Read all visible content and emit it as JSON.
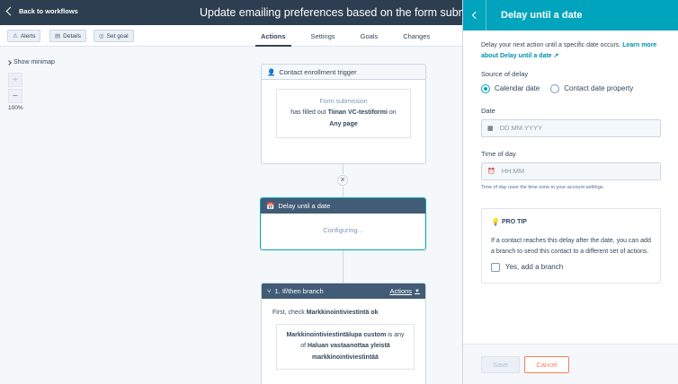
{
  "header": {
    "back_label": "Back to workflows",
    "workflow_title": "Update emailing preferences based on the form submission"
  },
  "toolbar": {
    "alerts_label": "Alerts",
    "details_label": "Details",
    "set_goal_label": "Set goal",
    "tabs": [
      {
        "label": "Actions",
        "active": true
      },
      {
        "label": "Settings",
        "active": false
      },
      {
        "label": "Goals",
        "active": false
      },
      {
        "label": "Changes",
        "active": false
      }
    ]
  },
  "canvas": {
    "minimap_label": "Show minimap",
    "zoom_in": "+",
    "zoom_out": "−",
    "zoom_level": "100%",
    "trigger": {
      "header": "Contact enrollment trigger",
      "line1": "Form submission",
      "line2_prefix": "has filled out",
      "form_name": "Tiinan VC-testiformi",
      "line2_suffix": "on",
      "line3": "Any page"
    },
    "delay_card": {
      "header": "Delay until a date",
      "body": "Configuring..."
    },
    "branch_card": {
      "header": "1. If/then branch",
      "actions_label": "Actions",
      "first_check_prefix": "First, check",
      "first_check_name": "Markkinointiviestintä ok",
      "property": "Markkinointiviestintälupa custom",
      "is_any_of": "is any",
      "of_text": "of",
      "value_line1": "Haluan vastaanottaa yleistä",
      "value_line2": "markkinointiviestintää"
    }
  },
  "panel": {
    "title": "Delay until a date",
    "description": "Delay your next action until a specific date occurs.",
    "learn_more": "Learn more about Delay until a date",
    "source_label": "Source of delay",
    "radio_calendar": "Calendar date",
    "radio_property": "Contact date property",
    "date_label": "Date",
    "date_placeholder": "DD.MM.YYYY",
    "time_label": "Time of day",
    "time_placeholder": "HH:MM",
    "time_helper": "Time of day uses the time zone in your account settings.",
    "tip_heading": "PRO TIP",
    "tip_text": "If a contact reaches this delay after the date, you can add a branch to send this contact to a different set of actions.",
    "tip_checkbox": "Yes, add a branch",
    "save_label": "Save",
    "cancel_label": "Cancel"
  },
  "colors": {
    "header_bg": "#2d3e50",
    "panel_accent": "#00a4bd",
    "cancel_accent": "#ff7a59",
    "link": "#0091ae"
  }
}
